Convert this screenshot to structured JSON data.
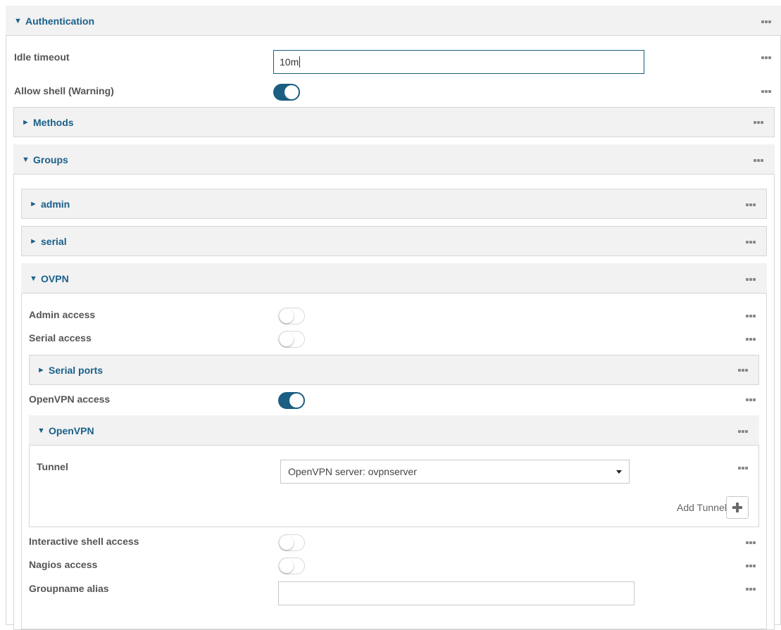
{
  "authentication": {
    "title": "Authentication",
    "idle_timeout": {
      "label": "Idle timeout",
      "value": "10m"
    },
    "allow_shell": {
      "label": "Allow shell (Warning)",
      "on": true
    },
    "methods": {
      "title": "Methods"
    },
    "groups": {
      "title": "Groups",
      "items": [
        {
          "title": "admin"
        },
        {
          "title": "serial"
        }
      ],
      "ovpn": {
        "title": "OVPN",
        "admin_access": {
          "label": "Admin access",
          "on": false
        },
        "serial_access": {
          "label": "Serial access",
          "on": false
        },
        "serial_ports": {
          "title": "Serial ports"
        },
        "openvpn_access": {
          "label": "OpenVPN access",
          "on": true
        },
        "openvpn": {
          "title": "OpenVPN",
          "tunnel": {
            "label": "Tunnel",
            "value": "OpenVPN server: ovpnserver"
          },
          "add_tunnel_label": "Add Tunnel"
        },
        "interactive_shell_access": {
          "label": "Interactive shell access",
          "on": false
        },
        "nagios_access": {
          "label": "Nagios access",
          "on": false
        },
        "groupname_alias": {
          "label": "Groupname alias",
          "value": ""
        }
      }
    }
  },
  "icons": {
    "expanded": "triangle-down-icon",
    "collapsed": "triangle-right-icon",
    "more": "more-options-icon",
    "add": "plus-icon"
  },
  "colors": {
    "accent": "#1a5e82",
    "title": "#19608a",
    "header_bg": "#f2f2f2"
  }
}
